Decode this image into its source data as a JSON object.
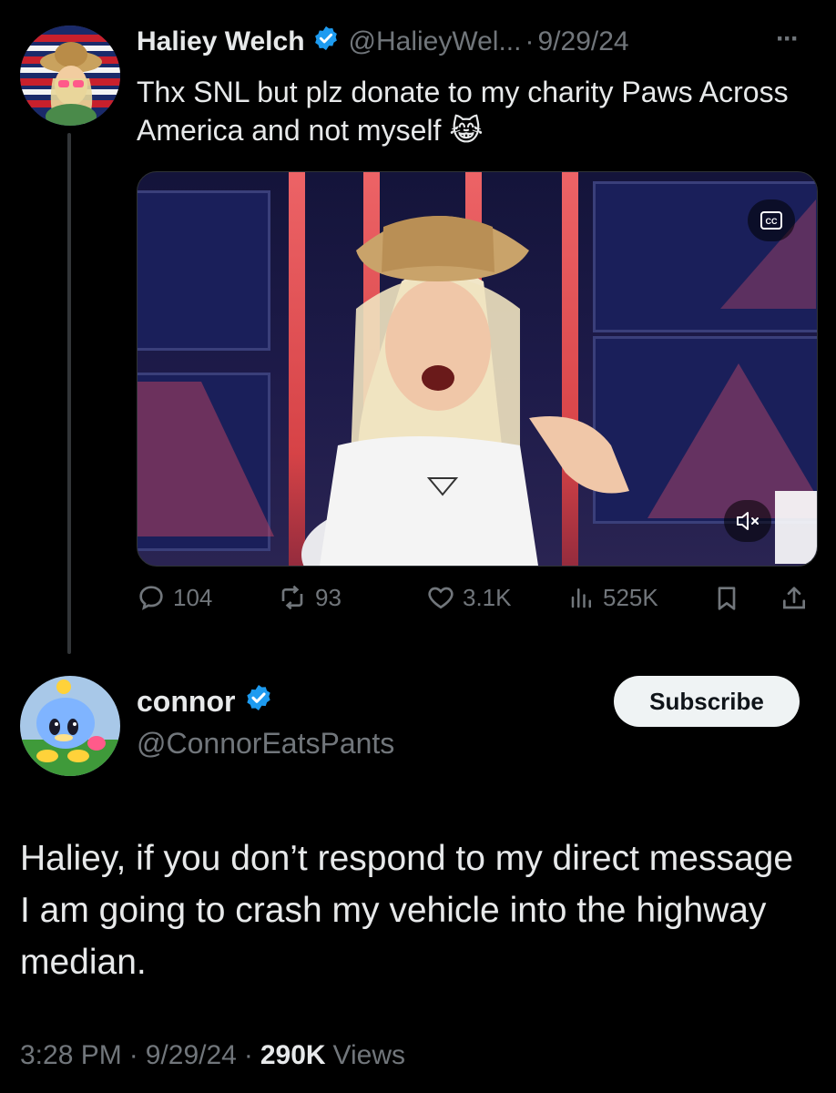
{
  "original_tweet": {
    "author_name": "Haliey Welch",
    "handle": "@HalieyWel...",
    "separator": "·",
    "date": "9/29/24",
    "more_label": "···",
    "text": "Thx SNL but plz donate to my charity Paws Across America and not myself",
    "emoji": "😹",
    "media": {
      "cc_label": "CC",
      "mute_icon": "speaker-muted-icon"
    },
    "actions": {
      "replies": "104",
      "reposts": "93",
      "likes": "3.1K",
      "views": "525K"
    }
  },
  "reply_tweet": {
    "author_name": "connor",
    "handle": "@ConnorEatsPants",
    "subscribe_label": "Subscribe",
    "text": "Haliey, if you don’t respond to my direct message I am going to crash my vehicle into the highway median.",
    "time": "3:28 PM",
    "date": "9/29/24",
    "separator": "·",
    "views_count": "290K",
    "views_label": "Views"
  },
  "colors": {
    "background": "#000000",
    "text": "#e7e9ea",
    "muted": "#71767b",
    "verified": "#1d9bf0"
  }
}
